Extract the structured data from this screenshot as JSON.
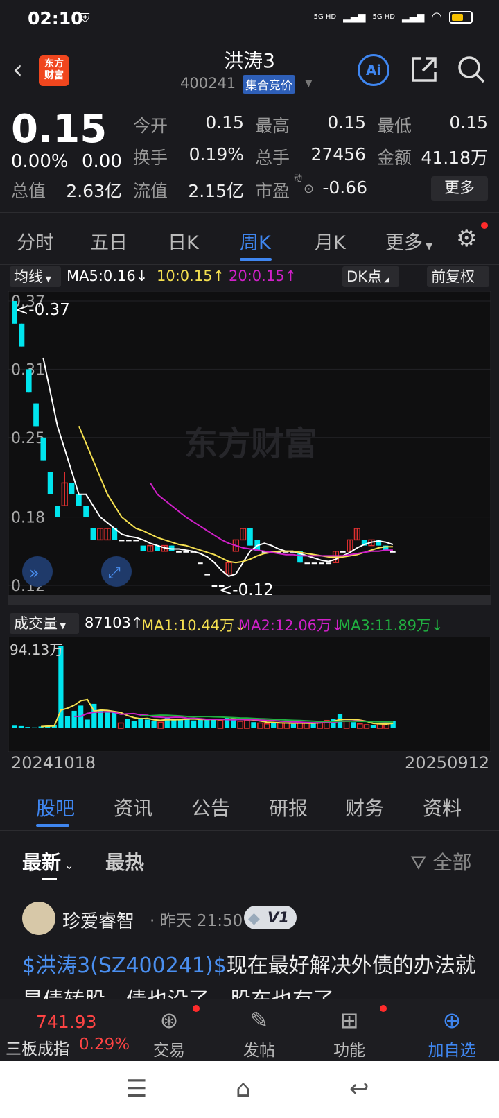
{
  "status": {
    "time": "02:10",
    "signal1": "5G HD",
    "signal2": "5G HD"
  },
  "header": {
    "title": "洪涛3",
    "code": "400241",
    "tag": "集合竞价",
    "logo_line1": "东方",
    "logo_line2": "财富",
    "ai": "Ai"
  },
  "quote": {
    "price": "0.15",
    "change_pct": "0.00%",
    "change": "0.00",
    "fields": [
      {
        "label": "今开",
        "value": "0.15"
      },
      {
        "label": "最高",
        "value": "0.15"
      },
      {
        "label": "最低",
        "value": "0.15"
      },
      {
        "label": "换手",
        "value": "0.19%"
      },
      {
        "label": "总手",
        "value": "27456"
      },
      {
        "label": "金额",
        "value": "41.18万"
      },
      {
        "label": "总值",
        "value": "2.63亿"
      },
      {
        "label": "流值",
        "value": "2.15亿"
      },
      {
        "label": "市盈",
        "value": "-0.66"
      }
    ],
    "pe_sup": "动",
    "more": "更多"
  },
  "period_tabs": [
    "分时",
    "五日",
    "日K",
    "周K",
    "月K",
    "更多"
  ],
  "active_period": "周K",
  "ma_legend": {
    "type": "均线",
    "ma5": "MA5:0.16",
    "ma10": "10:0.15",
    "ma20": "20:0.15",
    "dk": "DK点",
    "adjust": "前复权"
  },
  "kchart": {
    "watermark": "东方财富",
    "y_ticks": [
      "0.37",
      "0.31",
      "0.25",
      "0.18",
      "0.12"
    ],
    "max_label": "<-0.37",
    "min_label": "<-0.12"
  },
  "volume_legend": {
    "type": "成交量",
    "vol": "87103",
    "ma1": "MA1:10.44万",
    "ma2": "MA2:12.06万",
    "ma3": "MA3:11.89万",
    "max_label": "94.13万"
  },
  "dates": {
    "start": "20241018",
    "end": "20250912"
  },
  "content_tabs": [
    "股吧",
    "资讯",
    "公告",
    "研报",
    "财务",
    "资料"
  ],
  "sort": {
    "latest": "最新",
    "hot": "最热",
    "filter": "全部"
  },
  "post": {
    "user": "珍爱睿智",
    "time": "昨天 21:50",
    "badge": "V1",
    "link": "$洪涛3(SZ400241)$",
    "text": "现在最好解决外债的办法就是债转股，债也没了，股东也有了"
  },
  "bottom": {
    "index_value": "741.93",
    "index_name": "三板成指",
    "index_pct": "0.29%",
    "items": [
      "交易",
      "发帖",
      "功能",
      "加自选"
    ]
  },
  "colors": {
    "up": "#e03030",
    "down": "#00e5ee",
    "accent": "#3f86f0",
    "ma5": "#ffffff",
    "ma10": "#f5e050",
    "ma20": "#d020c8"
  },
  "chart_data": [
    {
      "type": "candlestick",
      "title": "",
      "ylim": [
        0.12,
        0.37
      ],
      "y_ticks": [
        0.37,
        0.31,
        0.25,
        0.18,
        0.12
      ],
      "candles": [
        {
          "o": 0.37,
          "c": 0.35,
          "h": 0.37,
          "l": 0.35
        },
        {
          "o": 0.35,
          "c": 0.33,
          "h": 0.35,
          "l": 0.33
        },
        {
          "o": 0.31,
          "c": 0.29,
          "h": 0.31,
          "l": 0.29
        },
        {
          "o": 0.28,
          "c": 0.26,
          "h": 0.28,
          "l": 0.26
        },
        {
          "o": 0.25,
          "c": 0.23,
          "h": 0.25,
          "l": 0.23
        },
        {
          "o": 0.22,
          "c": 0.2,
          "h": 0.22,
          "l": 0.2
        },
        {
          "o": 0.19,
          "c": 0.18,
          "h": 0.19,
          "l": 0.18
        },
        {
          "o": 0.19,
          "c": 0.21,
          "h": 0.22,
          "l": 0.19
        },
        {
          "o": 0.21,
          "c": 0.2,
          "h": 0.21,
          "l": 0.2
        },
        {
          "o": 0.2,
          "c": 0.19,
          "h": 0.2,
          "l": 0.19
        },
        {
          "o": 0.19,
          "c": 0.18,
          "h": 0.19,
          "l": 0.18
        },
        {
          "o": 0.17,
          "c": 0.16,
          "h": 0.17,
          "l": 0.16
        },
        {
          "o": 0.16,
          "c": 0.17,
          "h": 0.17,
          "l": 0.16
        },
        {
          "o": 0.16,
          "c": 0.17,
          "h": 0.17,
          "l": 0.16
        },
        {
          "o": 0.17,
          "c": 0.16,
          "h": 0.17,
          "l": 0.16
        },
        {
          "o": 0.16,
          "c": 0.16,
          "h": 0.16,
          "l": 0.16
        },
        {
          "o": 0.16,
          "c": 0.16,
          "h": 0.16,
          "l": 0.16
        },
        {
          "o": 0.16,
          "c": 0.16,
          "h": 0.16,
          "l": 0.16
        },
        {
          "o": 0.155,
          "c": 0.15,
          "h": 0.155,
          "l": 0.15
        },
        {
          "o": 0.15,
          "c": 0.155,
          "h": 0.155,
          "l": 0.15
        },
        {
          "o": 0.155,
          "c": 0.15,
          "h": 0.155,
          "l": 0.15
        },
        {
          "o": 0.15,
          "c": 0.155,
          "h": 0.155,
          "l": 0.15
        },
        {
          "o": 0.155,
          "c": 0.15,
          "h": 0.155,
          "l": 0.15
        },
        {
          "o": 0.15,
          "c": 0.15,
          "h": 0.15,
          "l": 0.15
        },
        {
          "o": 0.15,
          "c": 0.15,
          "h": 0.15,
          "l": 0.15
        },
        {
          "o": 0.15,
          "c": 0.15,
          "h": 0.15,
          "l": 0.15
        },
        {
          "o": 0.14,
          "c": 0.14,
          "h": 0.14,
          "l": 0.14
        },
        {
          "o": 0.13,
          "c": 0.13,
          "h": 0.13,
          "l": 0.13
        },
        {
          "o": 0.12,
          "c": 0.12,
          "h": 0.12,
          "l": 0.12
        },
        {
          "o": 0.12,
          "c": 0.12,
          "h": 0.12,
          "l": 0.12
        },
        {
          "o": 0.13,
          "c": 0.14,
          "h": 0.14,
          "l": 0.13
        },
        {
          "o": 0.15,
          "c": 0.16,
          "h": 0.16,
          "l": 0.15
        },
        {
          "o": 0.16,
          "c": 0.17,
          "h": 0.17,
          "l": 0.16
        },
        {
          "o": 0.17,
          "c": 0.155,
          "h": 0.17,
          "l": 0.155
        },
        {
          "o": 0.16,
          "c": 0.15,
          "h": 0.16,
          "l": 0.15
        },
        {
          "o": 0.15,
          "c": 0.15,
          "h": 0.15,
          "l": 0.15
        },
        {
          "o": 0.15,
          "c": 0.15,
          "h": 0.15,
          "l": 0.15
        },
        {
          "o": 0.15,
          "c": 0.15,
          "h": 0.15,
          "l": 0.15
        },
        {
          "o": 0.15,
          "c": 0.15,
          "h": 0.15,
          "l": 0.15
        },
        {
          "o": 0.15,
          "c": 0.15,
          "h": 0.15,
          "l": 0.15
        },
        {
          "o": 0.15,
          "c": 0.14,
          "h": 0.15,
          "l": 0.14
        },
        {
          "o": 0.14,
          "c": 0.14,
          "h": 0.14,
          "l": 0.14
        },
        {
          "o": 0.14,
          "c": 0.14,
          "h": 0.14,
          "l": 0.14
        },
        {
          "o": 0.14,
          "c": 0.14,
          "h": 0.14,
          "l": 0.14
        },
        {
          "o": 0.14,
          "c": 0.14,
          "h": 0.14,
          "l": 0.14
        },
        {
          "o": 0.14,
          "c": 0.15,
          "h": 0.15,
          "l": 0.14
        },
        {
          "o": 0.15,
          "c": 0.15,
          "h": 0.15,
          "l": 0.15
        },
        {
          "o": 0.15,
          "c": 0.16,
          "h": 0.16,
          "l": 0.15
        },
        {
          "o": 0.16,
          "c": 0.17,
          "h": 0.17,
          "l": 0.16
        },
        {
          "o": 0.16,
          "c": 0.155,
          "h": 0.16,
          "l": 0.155
        },
        {
          "o": 0.155,
          "c": 0.16,
          "h": 0.16,
          "l": 0.155
        },
        {
          "o": 0.16,
          "c": 0.155,
          "h": 0.16,
          "l": 0.155
        },
        {
          "o": 0.155,
          "c": 0.15,
          "h": 0.155,
          "l": 0.15
        },
        {
          "o": 0.15,
          "c": 0.15,
          "h": 0.15,
          "l": 0.15
        }
      ],
      "series": [
        {
          "name": "MA5",
          "values": [
            null,
            null,
            null,
            null,
            0.32,
            0.29,
            0.26,
            0.24,
            0.22,
            0.2,
            0.2,
            0.19,
            0.18,
            0.175,
            0.17,
            0.165,
            0.163,
            0.162,
            0.16,
            0.157,
            0.155,
            0.153,
            0.152,
            0.152,
            0.151,
            0.15,
            0.148,
            0.145,
            0.14,
            0.133,
            0.128,
            0.13,
            0.14,
            0.15,
            0.155,
            0.157,
            0.155,
            0.152,
            0.15,
            0.15,
            0.148,
            0.146,
            0.144,
            0.142,
            0.141,
            0.143,
            0.146,
            0.149,
            0.153,
            0.156,
            0.158,
            0.159,
            0.158,
            0.156
          ]
        },
        {
          "name": "MA10",
          "values": [
            null,
            null,
            null,
            null,
            null,
            null,
            null,
            null,
            null,
            0.26,
            0.245,
            0.23,
            0.215,
            0.2,
            0.19,
            0.18,
            0.175,
            0.17,
            0.168,
            0.165,
            0.162,
            0.16,
            0.158,
            0.156,
            0.155,
            0.153,
            0.151,
            0.149,
            0.147,
            0.144,
            0.141,
            0.14,
            0.141,
            0.143,
            0.146,
            0.148,
            0.149,
            0.15,
            0.15,
            0.15,
            0.149,
            0.148,
            0.147,
            0.146,
            0.145,
            0.145,
            0.145,
            0.146,
            0.147,
            0.149,
            0.151,
            0.153,
            0.154,
            0.154
          ]
        },
        {
          "name": "MA20",
          "values": [
            null,
            null,
            null,
            null,
            null,
            null,
            null,
            null,
            null,
            null,
            null,
            null,
            null,
            null,
            null,
            null,
            null,
            null,
            null,
            0.21,
            0.2,
            0.195,
            0.19,
            0.185,
            0.18,
            0.176,
            0.172,
            0.168,
            0.164,
            0.16,
            0.157,
            0.155,
            0.153,
            0.152,
            0.151,
            0.15,
            0.149,
            0.148,
            0.147,
            0.147,
            0.146,
            0.146,
            0.146,
            0.146,
            0.146,
            0.146,
            0.146,
            0.147,
            0.148,
            0.149,
            0.15,
            0.15,
            0.151,
            0.151
          ]
        }
      ]
    },
    {
      "type": "bar",
      "title": "",
      "ylim": [
        0,
        94.13
      ],
      "unit": "万",
      "values": [
        3,
        2.5,
        1.5,
        1,
        2,
        3,
        4,
        94.13,
        14,
        20,
        26,
        10,
        28,
        20,
        18,
        18,
        6,
        11,
        8,
        12,
        10,
        8,
        7,
        13,
        11,
        10,
        11,
        9,
        10,
        11,
        10,
        9,
        12,
        12,
        8,
        9,
        7,
        6,
        5,
        7,
        6,
        6,
        5,
        6,
        6,
        6,
        8,
        9,
        11,
        16,
        8,
        7,
        5,
        4,
        4,
        5,
        6,
        8.7
      ],
      "series": [
        {
          "name": "MA1",
          "values": [
            null,
            null,
            null,
            null,
            2,
            2.4,
            2.6,
            20.8,
            23,
            26.4,
            31.6,
            32.8,
            19.6,
            20.8,
            20.4,
            19.2,
            18,
            14.6,
            12.2,
            11,
            11.4,
            9.8,
            9.2,
            10,
            9.8,
            10,
            10.6,
            10.8,
            10.2,
            10.2,
            10.2,
            10.2,
            10.4,
            10.8,
            10.2,
            10,
            9.6,
            8.4,
            7,
            6.8,
            6.2,
            6,
            5.8,
            6,
            5.8,
            5.8,
            6.2,
            7,
            8,
            10,
            10.4,
            10.2,
            9.4,
            8,
            5.6,
            5,
            4.8,
            5.7
          ]
        },
        {
          "name": "MA2",
          "values": [
            null,
            null,
            null,
            null,
            null,
            null,
            null,
            null,
            null,
            13.6,
            13.8,
            17.1,
            18.4,
            18.6,
            18.9,
            18.4,
            16,
            16.5,
            16.8,
            15.2,
            14.9,
            13.2,
            12.8,
            12.3,
            12.7,
            12.8,
            11.6,
            11.5,
            11,
            10.3,
            10.4,
            10.4,
            10,
            9.8,
            10.2,
            10,
            10,
            9.6,
            8.9,
            8.9,
            8.2,
            7.9,
            7.4,
            7.1,
            6.6,
            6.3,
            6.3,
            6.6,
            6.9,
            7.9,
            8.3,
            8.5,
            8.3,
            8,
            8,
            7.5,
            7.1,
            7.0
          ]
        },
        {
          "name": "MA3",
          "values": [
            null,
            null,
            null,
            null,
            null,
            null,
            null,
            null,
            null,
            null,
            null,
            null,
            null,
            null,
            null,
            null,
            null,
            null,
            null,
            14.4,
            14.3,
            14.7,
            15.1,
            14.9,
            14.6,
            14.2,
            13.6,
            13.2,
            13.4,
            13.6,
            13.2,
            13,
            12.6,
            12.3,
            11.9,
            11.7,
            11.3,
            11,
            10.8,
            10.4,
            10,
            9.5,
            9.2,
            8.9,
            8.5,
            8.1,
            7.8,
            7.7,
            7.8,
            8.1,
            8.1,
            8.1,
            8,
            7.9,
            7.6,
            7.4,
            7.3,
            7.2
          ]
        }
      ]
    }
  ]
}
